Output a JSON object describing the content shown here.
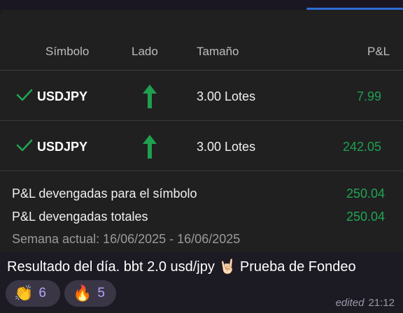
{
  "table": {
    "headers": {
      "symbol": "Símbolo",
      "side": "Lado",
      "size": "Tamaño",
      "pl": "P&L"
    },
    "rows": [
      {
        "symbol": "USDJPY",
        "side": "up-arrow-icon",
        "size": "3.00 Lotes",
        "pl": "7.99"
      },
      {
        "symbol": "USDJPY",
        "side": "up-arrow-icon",
        "size": "3.00 Lotes",
        "pl": "242.05"
      }
    ]
  },
  "summary": {
    "symbol_label": "P&L devengadas para el símbolo",
    "symbol_value": "250.04",
    "total_label": "P&L devengadas totales",
    "total_value": "250.04",
    "week": "Semana actual: 16/06/2025 - 16/06/2025"
  },
  "message": {
    "caption_a": "Resultado del día. bbt 2.0 usd/jpy",
    "caption_emoji": "🤘🏻",
    "caption_b": "Prueba de Fondeo",
    "reactions": [
      {
        "emoji": "👏",
        "count": "6"
      },
      {
        "emoji": "🔥",
        "count": "5"
      }
    ],
    "edited_label": "edited",
    "time": "21:12"
  },
  "colors": {
    "accent": "#2f6fd6",
    "profit": "#22a554",
    "check": "#22a554"
  }
}
